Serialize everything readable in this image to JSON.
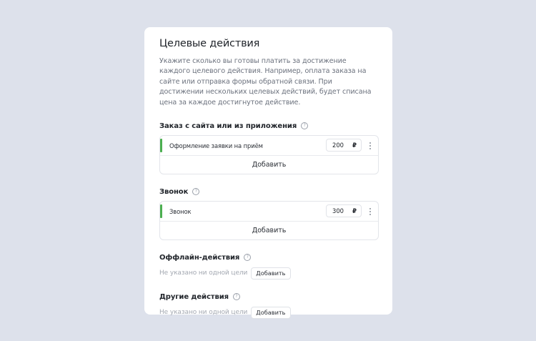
{
  "card": {
    "title": "Целевые действия",
    "description": "Укажите сколько вы готовы платить за достижение каждого целевого действия. Например, оплата заказа на сайте или отправка формы обратной связи. При достижении нескольких целевых действий, будет списана цена за каждое достигнутое действие."
  },
  "sections": {
    "order": {
      "title": "Заказ с сайта или из приложения",
      "item_label": "Оформление заявки на приём",
      "price": "200",
      "currency": "₽",
      "add_label": "Добавить"
    },
    "call": {
      "title": "Звонок",
      "item_label": "Звонок",
      "price": "300",
      "currency": "₽",
      "add_label": "Добавить"
    },
    "offline": {
      "title": "Оффлайн-действия",
      "empty_text": "Не указано ни одной цели",
      "add_label": "Добавить"
    },
    "other": {
      "title": "Другие действия",
      "empty_text": "Не указано ни одной цели",
      "add_label": "Добавить"
    }
  },
  "icons": {
    "help": "help-circle-icon",
    "more": "more-vertical-icon"
  },
  "colors": {
    "background": "#dde1eb",
    "card": "#ffffff",
    "accent": "#4caf50",
    "muted_text": "#a3a8b1"
  }
}
